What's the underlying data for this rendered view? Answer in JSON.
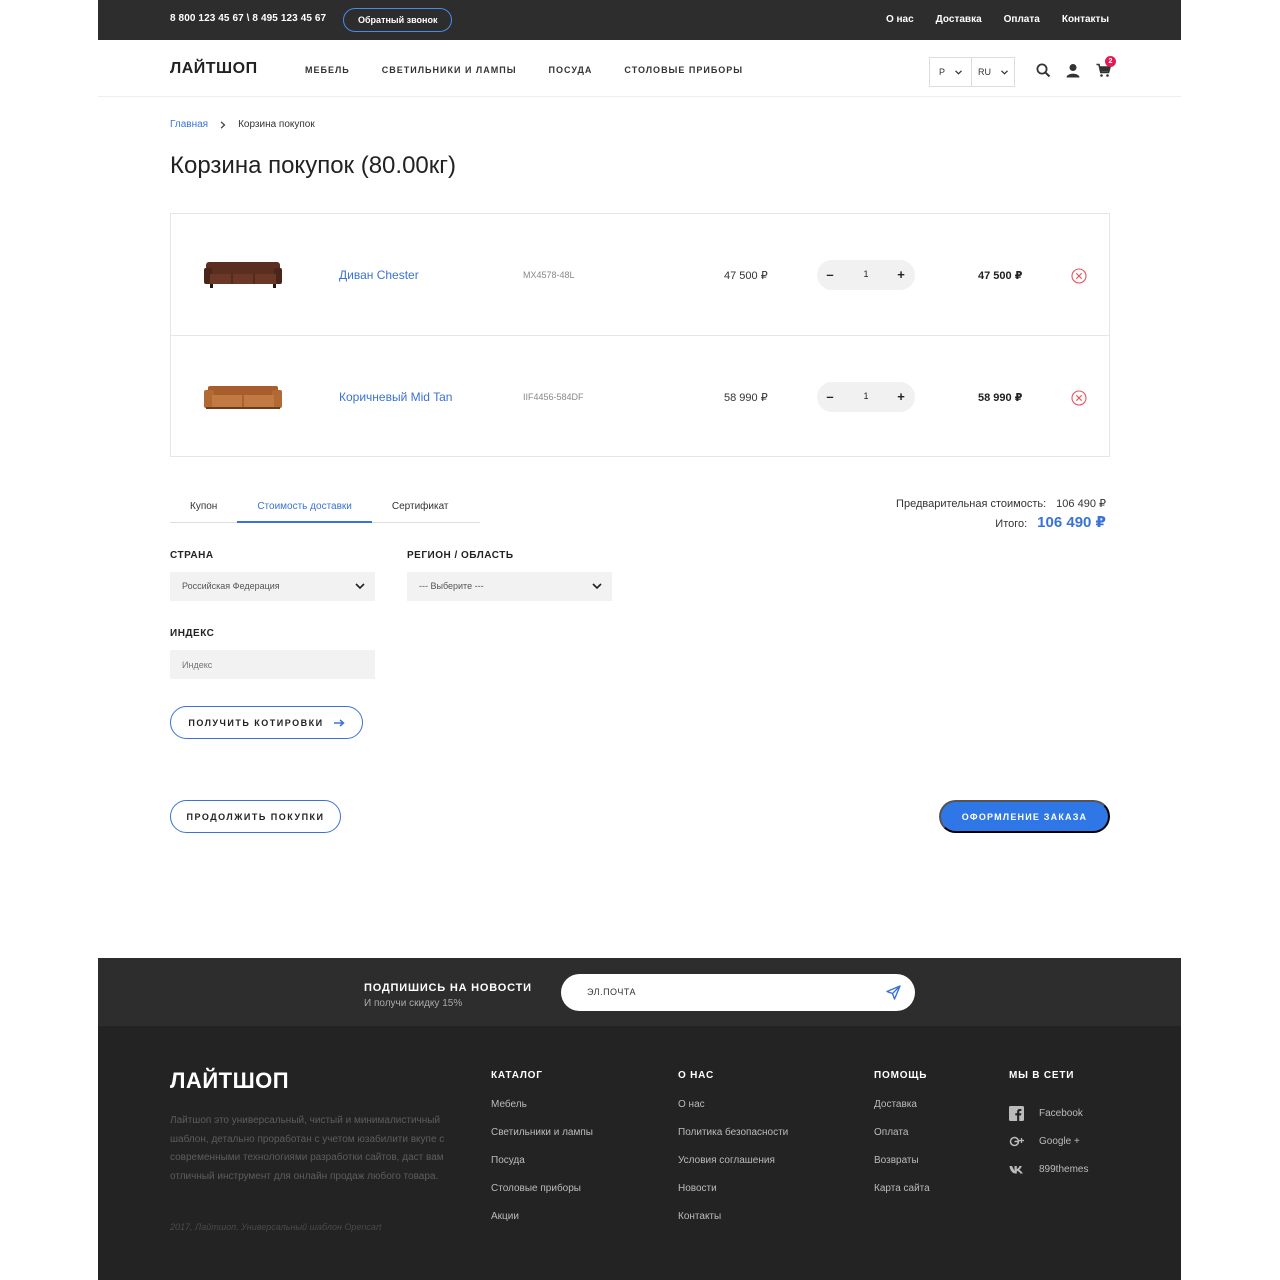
{
  "topbar": {
    "phones": "8 800 123 45 67 \\ 8 495 123 45 67",
    "callback": "Обратный звонок",
    "links": [
      "О нас",
      "Доставка",
      "Оплата",
      "Контакты"
    ]
  },
  "header": {
    "logo": "ЛАЙТШОП",
    "nav": [
      "МЕБЕЛЬ",
      "СВЕТИЛЬНИКИ И ЛАМПЫ",
      "ПОСУДА",
      "СТОЛОВЫЕ ПРИБОРЫ"
    ],
    "currency": "Р",
    "language": "RU",
    "cart_count": "2"
  },
  "breadcrumb": {
    "home": "Главная",
    "current": "Корзина покупок"
  },
  "page_title": "Корзина покупок (80.00кг)",
  "cart": {
    "items": [
      {
        "name": "Диван Chester",
        "sku": "MX4578-48L",
        "price": "47 500 ₽",
        "qty": "1",
        "total": "47 500 ₽",
        "color": "#5a2f22"
      },
      {
        "name": "Коричневый Mid Tan",
        "sku": "IIF4456-584DF",
        "price": "58 990 ₽",
        "qty": "1",
        "total": "58 990 ₽",
        "color": "#b26a35"
      }
    ]
  },
  "tabs": {
    "coupon": "Купон",
    "shipping": "Стоимость доставки",
    "certificate": "Сертификат"
  },
  "totals": {
    "subtotal_label": "Предварительная стоимость:",
    "subtotal_value": "106 490 ₽",
    "total_label": "Итого:",
    "total_value": "106 490 ₽"
  },
  "shipping_form": {
    "country_label": "СТРАНА",
    "country_value": "Российская Федерация",
    "region_label": "РЕГИОН / ОБЛАСТЬ",
    "region_value": "--- Выберите ---",
    "zip_label": "ИНДЕКС",
    "zip_placeholder": "Индекс",
    "quote_button": "ПОЛУЧИТЬ КОТИРОВКИ"
  },
  "actions": {
    "continue": "ПРОДОЛЖИТЬ ПОКУПКИ",
    "checkout": "ОФОРМЛЕНИЕ ЗАКАЗА"
  },
  "newsletter": {
    "title": "ПОДПИШИСЬ НА НОВОСТИ",
    "subtitle": "И получи скидку 15%",
    "placeholder": "ЭЛ.ПОЧТА"
  },
  "footer": {
    "logo": "ЛАЙТШОП",
    "description": "Лайтшоп это универсальный, чистый и минималистичный шаблон, детально проработан с учетом юзабилити вкупе с современными технологиями разработки сайтов, даст вам отличный инструмент для онлайн продаж любого товара.",
    "copyright": "2017, Лайтшоп. Универсальный шаблон Opencart",
    "catalog": {
      "title": "КАТАЛОГ",
      "items": [
        "Мебель",
        "Светильники и лампы",
        "Посуда",
        "Столовые приборы",
        "Акции"
      ]
    },
    "about": {
      "title": "О НАС",
      "items": [
        "О нас",
        "Политика безопасности",
        "Условия соглашения",
        "Новости",
        "Контакты"
      ]
    },
    "help": {
      "title": "ПОМОЩЬ",
      "items": [
        "Доставка",
        "Оплата",
        "Возвраты",
        "Карта сайта"
      ]
    },
    "social": {
      "title": "МЫ В СЕТИ",
      "items": [
        "Facebook",
        "Google +",
        "899themes"
      ]
    }
  },
  "colors": {
    "accent": "#2f76e6",
    "dark": "#2d2d2d",
    "footer": "#232323",
    "badge": "#e31b54"
  }
}
